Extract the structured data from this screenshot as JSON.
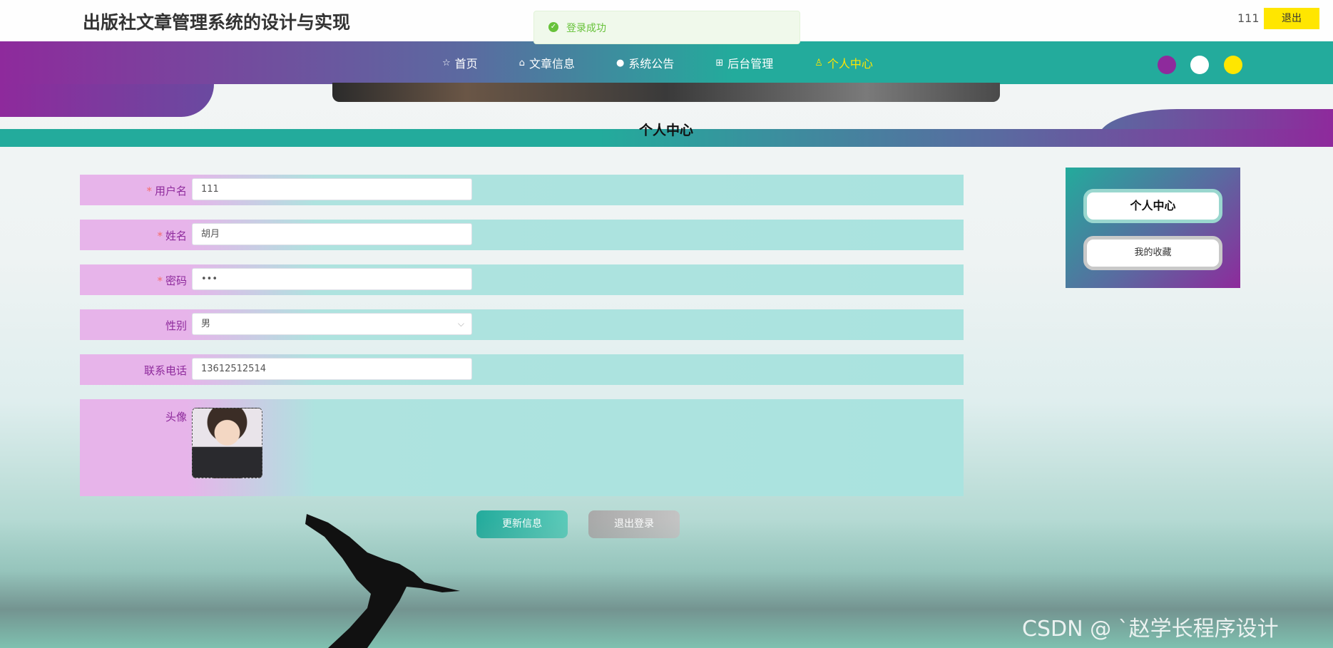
{
  "header": {
    "title": "出版社文章管理系统的设计与实现",
    "user": "111",
    "logout": "退出"
  },
  "toast": {
    "text": "登录成功"
  },
  "nav": {
    "items": [
      {
        "icon": "☆",
        "label": "首页"
      },
      {
        "icon": "⌂",
        "label": "文章信息"
      },
      {
        "icon": "●",
        "label": "系统公告"
      },
      {
        "icon": "⊞",
        "label": "后台管理"
      },
      {
        "icon": "♙",
        "label": "个人中心"
      }
    ],
    "theme_colors": [
      "#8e2a9c",
      "#ffffff",
      "#ffe600"
    ]
  },
  "section": {
    "title": "个人中心"
  },
  "form": {
    "username": {
      "label": "用户名",
      "value": "111",
      "required": true
    },
    "name": {
      "label": "姓名",
      "value": "胡月",
      "required": true
    },
    "password": {
      "label": "密码",
      "value": "•••",
      "required": true
    },
    "gender": {
      "label": "性别",
      "value": "男"
    },
    "phone": {
      "label": "联系电话",
      "value": "13612512514"
    },
    "avatar": {
      "label": "头像"
    }
  },
  "buttons": {
    "update": "更新信息",
    "logout": "退出登录"
  },
  "sidebar": {
    "items": [
      "个人中心",
      "我的收藏"
    ]
  },
  "watermark": "CSDN @ ˋ赵学长程序设计"
}
